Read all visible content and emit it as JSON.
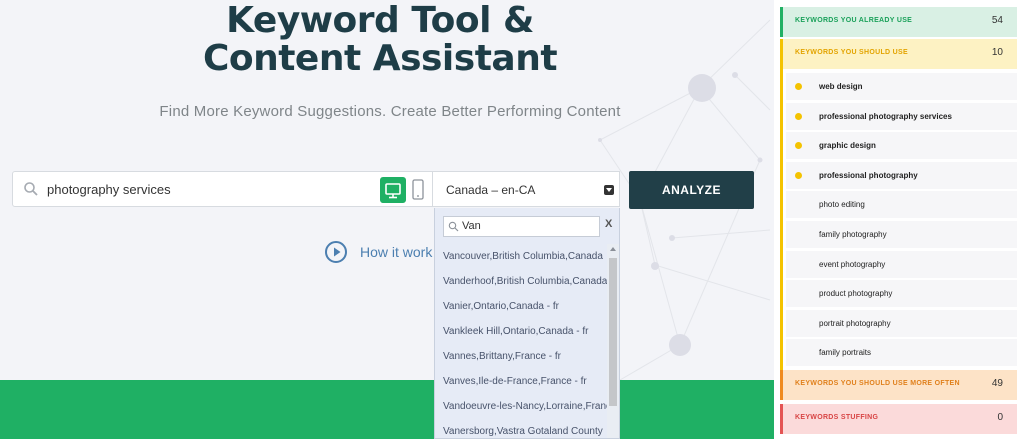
{
  "header": {
    "title_line1": "Keyword Tool &",
    "title_line2": "Content Assistant",
    "subtitle": "Find More Keyword Suggestions. Create Better Performing Content"
  },
  "search": {
    "value": "photography services",
    "icon": "search-icon",
    "device_desktop_icon": "desktop-icon",
    "device_mobile_icon": "mobile-icon"
  },
  "locale": {
    "selected": "Canada – en-CA",
    "filter_value": "Van",
    "close_label": "X",
    "options": [
      "Vancouver,British Columbia,Canada",
      "Vanderhoof,British Columbia,Canada",
      "Vanier,Ontario,Canada - fr",
      "Vankleek Hill,Ontario,Canada - fr",
      "Vannes,Brittany,France - fr",
      "Vanves,Ile-de-France,France - fr",
      "Vandoeuvre-les-Nancy,Lorraine,France",
      "Vanersborg,Vastra Gotaland County"
    ]
  },
  "analyze_button": {
    "label": "ANALYZE"
  },
  "how_it_works": {
    "label": "How it work"
  },
  "sidebar": {
    "already_use": {
      "label": "KEYWORDS YOU ALREADY USE",
      "count": "54"
    },
    "should_use": {
      "label": "KEYWORDS YOU SHOULD USE",
      "count": "10",
      "items": [
        {
          "text": "web design",
          "dot": true
        },
        {
          "text": "professional photography services",
          "dot": true
        },
        {
          "text": "graphic design",
          "dot": true
        },
        {
          "text": "professional photography",
          "dot": true
        },
        {
          "text": "photo editing",
          "dot": false
        },
        {
          "text": "family photography",
          "dot": false
        },
        {
          "text": "event photography",
          "dot": false
        },
        {
          "text": "product photography",
          "dot": false
        },
        {
          "text": "portrait photography",
          "dot": false
        },
        {
          "text": "family portraits",
          "dot": false
        }
      ]
    },
    "more_often": {
      "label": "KEYWORDS YOU SHOULD USE MORE OFTEN",
      "count": "49"
    },
    "stuffing": {
      "label": "KEYWORDS STUFFING",
      "count": "0"
    }
  },
  "colors": {
    "brand_dark": "#1e3d47",
    "accent_green": "#1fb064",
    "yellow": "#f4c300",
    "orange": "#ef8a1f",
    "red": "#e45454"
  }
}
